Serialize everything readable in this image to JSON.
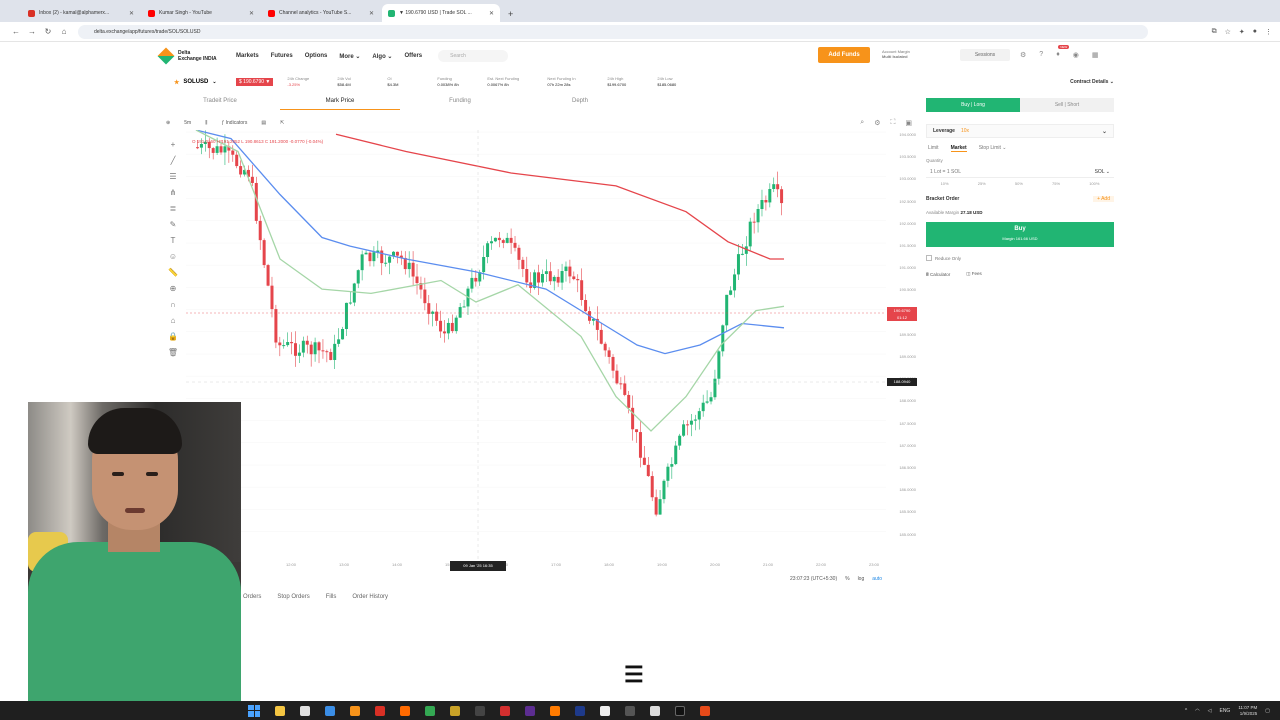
{
  "browser": {
    "tabs": [
      {
        "title": "Inbox (2) - kamal@alphamerx...",
        "color": "#d93025",
        "active": false
      },
      {
        "title": "Kumar Singh - YouTube",
        "color": "#ff0000",
        "active": false
      },
      {
        "title": "Channel analytics - YouTube S...",
        "color": "#ff0000",
        "active": false
      },
      {
        "title": "▼ 190.6790 USD | Trade SOL ...",
        "color": "#21b573",
        "active": true
      }
    ],
    "new_tab": "+",
    "url": "delta.exchange/app/futures/trade/SOL/SOLUSD"
  },
  "app": {
    "logo_line1": "Delta",
    "logo_line2": "Exchange INDIA",
    "nav": [
      "Markets",
      "Futures",
      "Options",
      "More ⌄",
      "Algo ⌄",
      "Offers"
    ],
    "search_placeholder": "Search",
    "add_funds": "Add Funds",
    "account_mode_label": "Account Margin",
    "account_mode_value": "Multi Isolated",
    "sessions": "Sessions",
    "notification_badge": "NEW"
  },
  "ticker": {
    "symbol": "SOLUSD",
    "last_price": "$ 190.6790 ▼",
    "stats": [
      {
        "label": "24h Change",
        "value": "-3.25%",
        "negative": true
      },
      {
        "label": "24h Vol",
        "value": "$58.4M",
        "negative": false
      },
      {
        "label": "OI",
        "value": "$4.3M",
        "negative": false
      },
      {
        "label": "Funding",
        "value": "0.0038% 8h",
        "negative": false
      },
      {
        "label": "Est. Next Funding",
        "value": "0.0067% 8h",
        "negative": false
      },
      {
        "label": "Next Funding In",
        "value": "07h 22m 28s",
        "negative": false
      },
      {
        "label": "24h High",
        "value": "$199.6700",
        "negative": false
      },
      {
        "label": "24h Low",
        "value": "$185.0680",
        "negative": false
      }
    ],
    "contract_details": "Contract Details ⌄"
  },
  "chart": {
    "tabs": [
      "Tradeit Price",
      "Mark Price",
      "Funding",
      "Depth"
    ],
    "active_tab": 1,
    "toolbar": {
      "interval": "5m",
      "indicators": "Indicators"
    },
    "ohlc_text": "O 191.0160  H 191.2852  L 190.8613  C 191.2000  -0.0770 (-0.04%)",
    "y_ticks": [
      "194.0000",
      "193.5000",
      "193.0000",
      "192.5000",
      "192.0000",
      "191.5000",
      "191.0000",
      "190.5000",
      "190.0000",
      "189.5000",
      "189.0000",
      "188.5000",
      "188.0000",
      "187.5000",
      "187.0000",
      "186.5000",
      "186.0000",
      "185.5000",
      "185.0000"
    ],
    "current_price_label": "190.6790",
    "current_price_sub": "01:12",
    "crosshair_price": "188.0940",
    "x_ticks": [
      "12:00",
      "13:00",
      "14:00",
      "15:00",
      "16:00",
      "17:00",
      "18:00",
      "19:00",
      "20:00",
      "21:00",
      "22:00",
      "23:00"
    ],
    "crosshair_time": "09 Jan '25  16:35",
    "timezone": "23:07:23 (UTC+5:30)",
    "percent_toggle": "%",
    "log_toggle": "log",
    "auto_toggle": "auto",
    "colors": {
      "up": "#21b573",
      "down": "#e5454b",
      "ma_slow": "#e5454b",
      "ma_mid": "#5b8def",
      "ma_fast": "#a5d6a7"
    }
  },
  "orders_tabs": [
    "Orders",
    "Stop Orders",
    "Fills",
    "Order History"
  ],
  "order_panel": {
    "buy_tab": "Buy | Long",
    "sell_tab": "Sell | Short",
    "leverage_label": "Leverage",
    "leverage_value": "10x",
    "order_types": [
      "Limit",
      "Market",
      "Stop Limit ⌄"
    ],
    "active_order_type": 1,
    "quantity_label": "Quantity",
    "quantity_value": "1 Lot = 1 SOL",
    "quantity_unit": "SOL ⌄",
    "percents": [
      "10%",
      "25%",
      "50%",
      "75%",
      "100%"
    ],
    "bracket_label": "Bracket Order",
    "bracket_add": "+ Add",
    "available_label": "Available Margin",
    "available_value": "27.18 USD",
    "buy_button": "Buy",
    "buy_margin": "Margin 161.66 USD",
    "reduce_only": "Reduce Only",
    "calculator": "Calculator",
    "fees": "Fees"
  },
  "taskbar": {
    "time": "11:07 PM",
    "date": "1/9/2025",
    "lang": "ENG"
  }
}
